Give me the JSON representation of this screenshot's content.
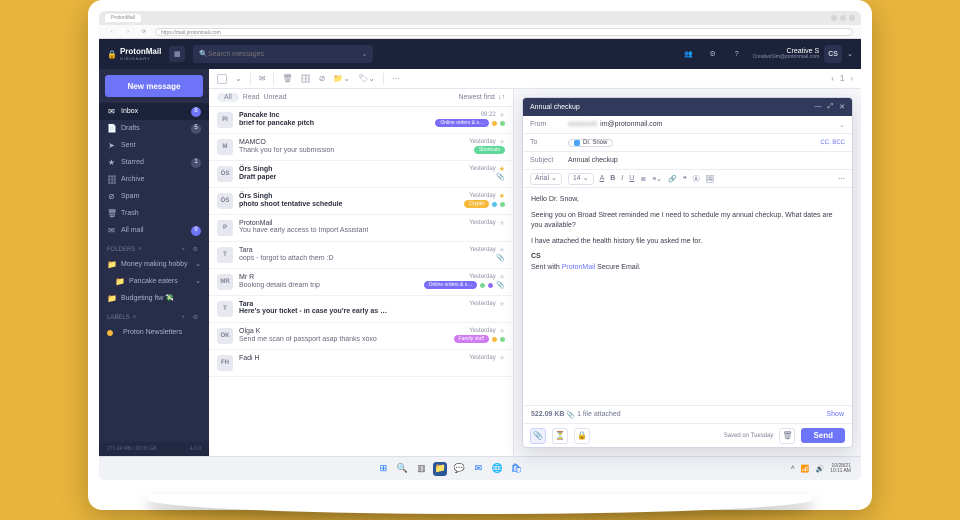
{
  "browser": {
    "tab_title": "ProtonMail",
    "url": "https://mail.protonmail.com"
  },
  "brand": {
    "name": "ProtonMail",
    "tier": "VISIONARY"
  },
  "search": {
    "placeholder": "Search messages"
  },
  "user": {
    "name": "Creative S",
    "email": "CreativeSim@protonmail.com",
    "initials": "CS"
  },
  "sidebar": {
    "new_message": "New message",
    "items": [
      {
        "icon": "✉",
        "label": "Inbox",
        "badge": "8",
        "active": true
      },
      {
        "icon": "📄",
        "label": "Drafts",
        "badge": "5",
        "gray": true
      },
      {
        "icon": "➤",
        "label": "Sent"
      },
      {
        "icon": "★",
        "label": "Starred",
        "badge": "1",
        "gray": true
      },
      {
        "icon": "🗄",
        "label": "Archive"
      },
      {
        "icon": "⊘",
        "label": "Spam"
      },
      {
        "icon": "🗑",
        "label": "Trash"
      },
      {
        "icon": "✉",
        "label": "All mail",
        "badge": "9"
      }
    ],
    "folders_header": "FOLDERS",
    "folders": [
      {
        "label": "Money making hobby",
        "arrow": true
      },
      {
        "label": "Pancake eaters",
        "arrow": true,
        "sub": true
      },
      {
        "label": "Budgeting ftw 💸"
      }
    ],
    "labels_header": "LABELS",
    "labels": [
      {
        "color": "#f6b93b",
        "label": "Proton Newsletters"
      }
    ],
    "footer_left": "271.04 MB / 20.00 GB",
    "footer_right": "4.0.0"
  },
  "listHeader": {
    "all": "All",
    "read": "Read",
    "unread": "Unread",
    "sort": "Newest first"
  },
  "messages": [
    {
      "av": "PI",
      "from": "Pancake Inc",
      "time": "09:22",
      "subj": "brief for pancake pitch",
      "bold": true,
      "star": false,
      "tags": [
        {
          "text": "Online orders & s…",
          "bg": "#7b6df7"
        }
      ],
      "dots": [
        "#f6b93b",
        "#7bd88f"
      ]
    },
    {
      "av": "M",
      "from": "MAMCO",
      "time": "Yesterday",
      "subj": "Thank you for your submission",
      "star": false,
      "tags": [
        {
          "text": "Shortcuts",
          "bg": "#5fd99a"
        }
      ]
    },
    {
      "av": "ÖS",
      "from": "Örs Singh",
      "time": "Yesterday",
      "subj": "Draft paper",
      "bold": true,
      "star": true,
      "clip": true
    },
    {
      "av": "ÖS",
      "from": "Örs Singh",
      "time": "Yesterday",
      "subj": "photo shoot tentative schedule",
      "bold": true,
      "star": true,
      "tags": [
        {
          "text": "Crypto",
          "bg": "#f6b93b"
        }
      ],
      "dots": [
        "#55c0e8",
        "#7bd88f"
      ]
    },
    {
      "av": "P",
      "from": "ProtonMail",
      "time": "Yesterday",
      "subj": "You have early access to Import Assistant"
    },
    {
      "av": "T",
      "from": "Tara",
      "time": "Yesterday",
      "subj": "oops - forgot to attach them :D",
      "clip": true
    },
    {
      "av": "MR",
      "from": "Mr R",
      "time": "Yesterday",
      "subj": "Booking details dream trip",
      "tags": [
        {
          "text": "Online orders & s…",
          "bg": "#7b6df7"
        }
      ],
      "dots": [
        "#7bd88f",
        "#8d6df7"
      ],
      "clip": true
    },
    {
      "av": "T",
      "from": "Tara",
      "time": "Yesterday",
      "subj": "Here's your ticket - in case you're early as always :)",
      "bold": true
    },
    {
      "av": "OK",
      "from": "Olga K",
      "time": "Yesterday",
      "subj": "Send me scan of passport asap thanks xoxo",
      "tags": [
        {
          "text": "Family stuff",
          "bg": "#d07bf0"
        }
      ],
      "dots": [
        "#f6b93b",
        "#7bd88f"
      ]
    },
    {
      "av": "FH",
      "from": "Fadi H",
      "time": "Yesterday",
      "subj": ""
    }
  ],
  "compose": {
    "title": "Annual checkup",
    "from_label": "From",
    "from_value": "im@protonmail.com",
    "to_label": "To",
    "to_chip": "Dr. Snow",
    "cc": "CC",
    "bcc": "BCC",
    "subject_label": "Subject",
    "subject_value": "Annual checkup",
    "font": "Arial",
    "size": "14",
    "body_greeting": "Hello Dr. Snow,",
    "body_p1": "Seeing you on Broad Street reminded me I need to schedule my annual checkup. What dates are you available?",
    "body_p2": "I have attached the health history file you asked me for.",
    "sig_name": "CS",
    "sig_line_pre": "Sent with ",
    "sig_link": "ProtonMail",
    "sig_line_post": " Secure Email.",
    "attach_size": "522.09 KB",
    "attach_count": "1 file attached",
    "show": "Show",
    "saved": "Saved on Tuesday",
    "send": "Send"
  },
  "taskbar": {
    "date": "10/28/21",
    "time": "10:11 AM"
  }
}
